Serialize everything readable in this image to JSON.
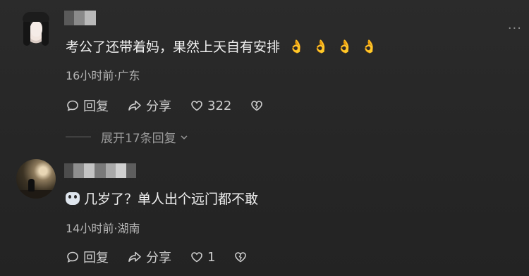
{
  "thread": {
    "comments": [
      {
        "text": "考公了还带着妈，果然上天自有安排",
        "emoji": [
          "👌",
          "👌",
          "👌",
          "👌"
        ],
        "meta": "16小时前·广东",
        "reply_label": "回复",
        "share_label": "分享",
        "like_count": "322"
      },
      {
        "text": "几岁了？单人出个远门都不敢",
        "meta": "14小时前·湖南",
        "reply_label": "回复",
        "share_label": "分享",
        "like_count": "1"
      }
    ],
    "expand_label": "展开17条回复",
    "more_menu": "···"
  },
  "colors": {
    "background": "#262626",
    "primary_text": "#f0f0f0",
    "secondary_text": "#b5b5b5",
    "emoji": "#f5c242"
  },
  "icons": [
    "more-icon",
    "reply-icon",
    "share-icon",
    "heart-icon",
    "dislike-icon",
    "chevron-down-icon",
    "avatar"
  ]
}
